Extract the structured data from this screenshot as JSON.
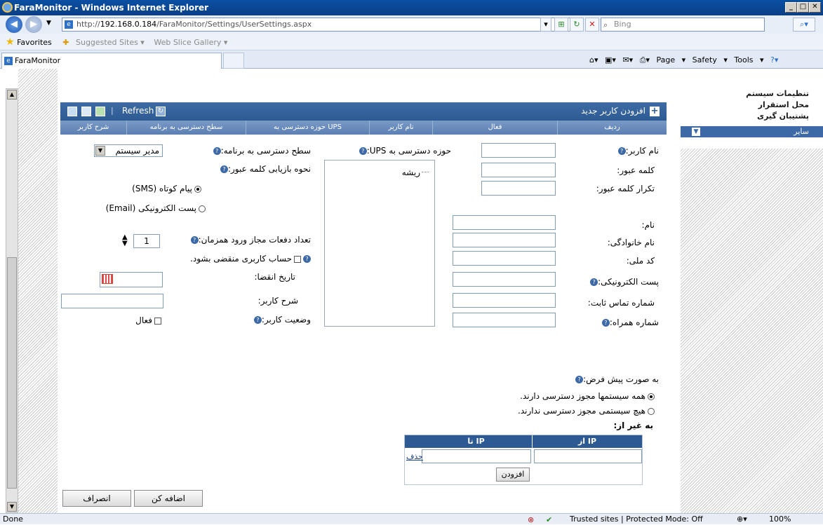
{
  "browser": {
    "window_title": "FaraMonitor - Windows Internet Explorer",
    "url_prefix": "http://",
    "url_host": "192.168.0.184",
    "url_path": "/FaraMonitor/Settings/UserSettings.aspx",
    "search_placeholder": "Bing",
    "favorites_label": "Favorites",
    "fav_suggested": "Suggested Sites ▾",
    "fav_webslice": "Web Slice Gallery ▾",
    "tab_title": "FaraMonitor",
    "cmd_page": "Page ▾",
    "cmd_safety": "Safety ▾",
    "cmd_tools": "Tools ▾",
    "status_left": "Done",
    "status_zone": "Trusted sites | Protected Mode: Off",
    "status_zoom": "100%"
  },
  "right_menu": {
    "items": [
      "تنظیمات سیستم",
      "محل استقرار",
      "پشتیبان گیری"
    ],
    "selected": "سایر"
  },
  "grid": {
    "add_user": "افزودن کاربر جدید",
    "refresh": "Refresh",
    "columns": [
      "ردیف",
      "فعال",
      "نام کاربر",
      "حوزه دسترسی به UPS",
      "سطح دسترسی به برنامه",
      "شرح کاربر"
    ]
  },
  "form": {
    "username": "نام کاربر:",
    "password": "کلمه عبور:",
    "password_repeat": "تکرار کلمه عبور:",
    "first_name": "نام:",
    "last_name": "نام خانوادگی:",
    "national_code": "کد ملی:",
    "email": "پست الکترونیکی:",
    "phone": "شماره تماس ثابت:",
    "mobile": "شماره همراه:",
    "ups_scope": "حوزه دسترسی به UPS:",
    "tree_root": "ریشه",
    "access_level": "سطح دسترسی به برنامه:",
    "access_level_value": "مدیر سیستم",
    "recovery_method": "نحوه بازیابی کلمه عبور:",
    "recovery_sms": "پیام کوتاه (SMS)",
    "recovery_email": "پست الکترونیکی (Email)",
    "concurrent_logins": "تعداد دفعات مجاز ورود همزمان:",
    "concurrent_value": "1",
    "account_expires": "حساب کاربری منقضی بشود.",
    "expiry_date": "تاریخ انقضا:",
    "description": "شرح کاربر:",
    "status": "وضعیت کاربر:",
    "active": "فعال",
    "default_label": "به صورت پیش فرض:",
    "all_allowed": "همه سیستمها مجوز دسترسی دارند.",
    "none_allowed": "هیچ سیستمی مجوز دسترسی ندارند.",
    "except": "به غیر از:",
    "ip_from": "از IP",
    "ip_to": "تا IP",
    "delete": "حذف",
    "add_ip": "افزودن",
    "submit": "اضافه کن",
    "cancel": "انصراف"
  },
  "colors": {
    "header_blue": "#2d5a93",
    "menu_selected": "#3d6aa6"
  }
}
